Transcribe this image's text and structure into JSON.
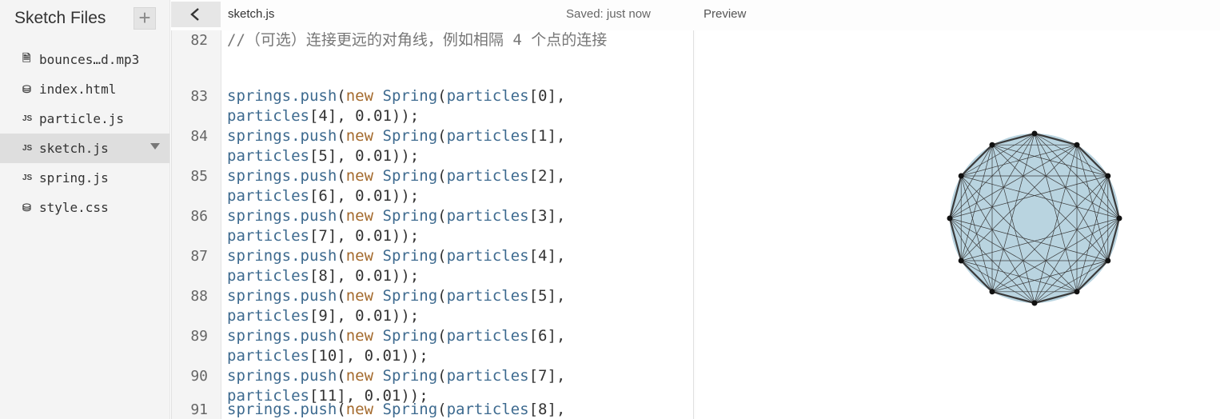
{
  "sidebar": {
    "title": "Sketch Files",
    "add_button": "+",
    "files": [
      {
        "name": "bounces…d.mp3",
        "icon": "file-icon",
        "badge": "🗎"
      },
      {
        "name": "index.html",
        "icon": "html-file-icon",
        "badge": "⛁"
      },
      {
        "name": "particle.js",
        "icon": "js-file-icon",
        "badge": "JS"
      },
      {
        "name": "sketch.js",
        "icon": "js-file-icon",
        "badge": "JS",
        "selected": true
      },
      {
        "name": "spring.js",
        "icon": "js-file-icon",
        "badge": "JS"
      },
      {
        "name": "style.css",
        "icon": "css-file-icon",
        "badge": "⛁"
      }
    ]
  },
  "editor": {
    "tab_title": "sketch.js",
    "save_status": "Saved: just now",
    "lines": [
      {
        "number": "82",
        "comment": "//（可选）连接更远的对角线，例如相隔 4 个点的连接"
      },
      {
        "number": "83",
        "from": "particles[0],",
        "to": "particles[4], 0.01));"
      },
      {
        "number": "84",
        "from": "particles[1],",
        "to": "particles[5], 0.01));"
      },
      {
        "number": "85",
        "from": "particles[2],",
        "to": "particles[6], 0.01));"
      },
      {
        "number": "86",
        "from": "particles[3],",
        "to": "particles[7], 0.01));"
      },
      {
        "number": "87",
        "from": "particles[4],",
        "to": "particles[8], 0.01));"
      },
      {
        "number": "88",
        "from": "particles[5],",
        "to": "particles[9], 0.01));"
      },
      {
        "number": "89",
        "from": "particles[6],",
        "to": "particles[10], 0.01));"
      },
      {
        "number": "90",
        "from": "particles[7],",
        "to": "particles[11], 0.01));"
      },
      {
        "number": "91",
        "from": "particles[8],",
        "to": ""
      }
    ],
    "code_prefix": {
      "obj": "springs",
      "method": ".push",
      "kw": "new",
      "cls": "Spring"
    }
  },
  "preview": {
    "title": "Preview",
    "sketch": {
      "particle_count": 12,
      "skip_connections": [
        1,
        2,
        3,
        4,
        5
      ],
      "fill_color": "#b9d4e0",
      "line_color": "#3a3a3a",
      "point_color": "#111111"
    }
  },
  "colors": {
    "sidebar_bg": "#f4f4f4",
    "selected_file_bg": "#dedede",
    "code_identifier": "#3d6a8f",
    "code_keyword": "#a46a2d",
    "comment": "#777777"
  }
}
